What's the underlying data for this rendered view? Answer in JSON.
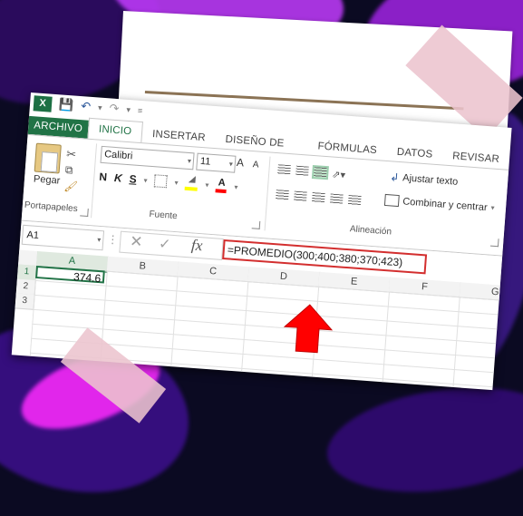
{
  "window": {
    "tabs": [
      "ARCHIVO",
      "INICIO",
      "INSERTAR",
      "DISEÑO DE PÁGINA",
      "FÓRMULAS",
      "DATOS",
      "REVISAR"
    ],
    "active_tab": "INICIO",
    "qat_logo": "X"
  },
  "ribbon": {
    "clipboard": {
      "paste_label": "Pegar",
      "group_label": "Portapapeles"
    },
    "font": {
      "name": "Calibri",
      "size": "11",
      "grow": "A",
      "shrink": "A",
      "bold": "N",
      "italic": "K",
      "underline": "S",
      "font_color_glyph": "A",
      "group_label": "Fuente"
    },
    "alignment": {
      "wrap_text": "Ajustar texto",
      "merge_center": "Combinar y centrar",
      "group_label": "Alineación"
    }
  },
  "formula_bar": {
    "name_box": "A1",
    "fx": "fx",
    "formula": "=PROMEDIO(300;400;380;370;423)"
  },
  "grid": {
    "columns": [
      "A",
      "B",
      "C",
      "D",
      "E",
      "F",
      "G"
    ],
    "rows": [
      "1",
      "2",
      "3"
    ],
    "selected_column": "A",
    "cells": {
      "A1": "374.6"
    }
  },
  "colors": {
    "excel_green": "#217346",
    "highlight_red": "#d32f2f",
    "arrow_red": "#ff0000"
  }
}
